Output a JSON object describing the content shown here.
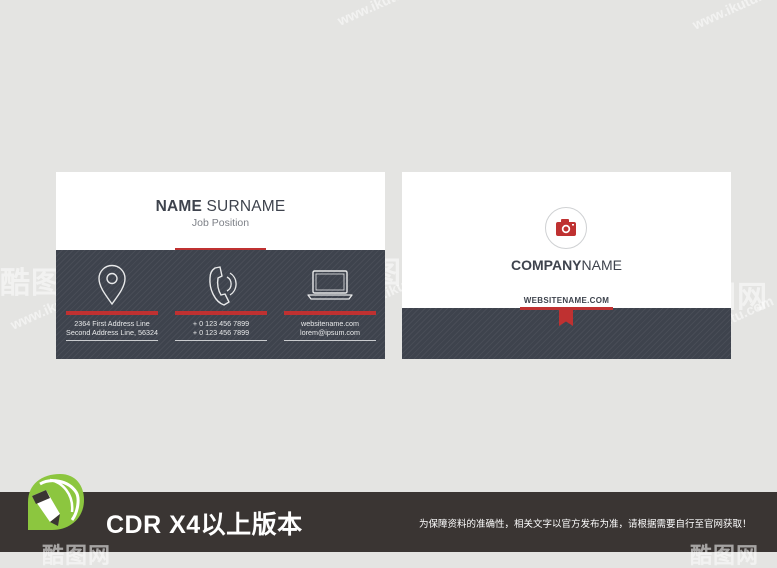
{
  "colors": {
    "background": "#e4e4e2",
    "card_dark": "#3e434d",
    "accent_red": "#bf3131",
    "footer": "#3a3533",
    "text_dark": "#3e434d"
  },
  "watermark": {
    "brand": "酷图网",
    "url": "www.ikutu.com"
  },
  "front_card": {
    "name_first": "NAME",
    "name_last": "SURNAME",
    "position": "Job Position",
    "columns": [
      {
        "icon": "location-pin-icon",
        "line1": "2364 First Address Line",
        "line2": "Second Address Line, 56324"
      },
      {
        "icon": "phone-icon",
        "line1": "+ 0 123 456 7899",
        "line2": "+ 0 123 456 7899"
      },
      {
        "icon": "laptop-icon",
        "line1": "websitename.com",
        "line2": "lorem@ipsum.com"
      }
    ]
  },
  "back_card": {
    "icon": "camera-icon",
    "company_bold": "COMPANY",
    "company_regular": "NAME",
    "website": "WEBSITENAME.COM"
  },
  "footer": {
    "logo_icon": "coreldraw-pen-icon",
    "version_label": "CDR X4以上版本",
    "disclaimer": "为保障资料的准确性，相关文字以官方发布为准，请根据需要自行至官网获取！"
  }
}
